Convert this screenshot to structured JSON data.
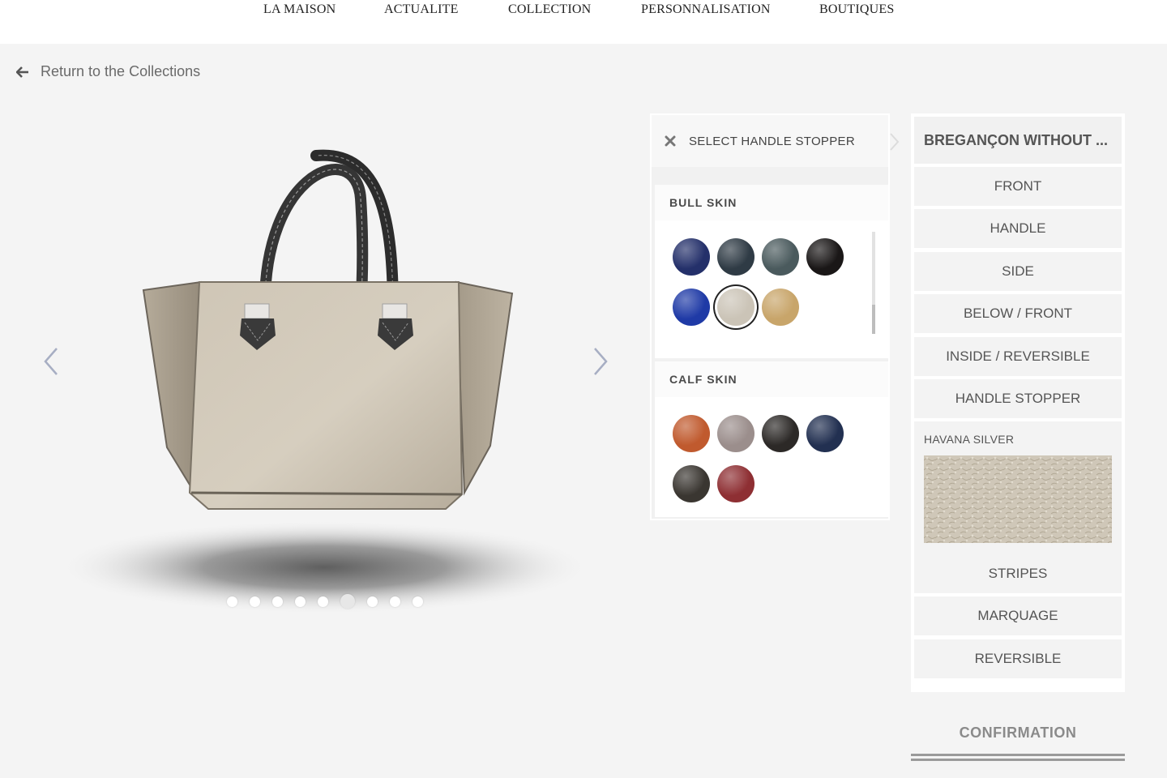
{
  "nav": {
    "items": [
      "LA MAISON",
      "ACTUALITE",
      "COLLECTION",
      "PERSONNALISATION",
      "BOUTIQUES"
    ]
  },
  "back": {
    "label": "Return to the Collections",
    "icon": "arrow-left-icon"
  },
  "carousel": {
    "dot_count": 9,
    "active_index": 5,
    "prev_icon": "chevron-left-icon",
    "next_icon": "chevron-right-icon"
  },
  "material_panel": {
    "title": "SELECT HANDLE STOPPER",
    "close_icon": "close-icon",
    "sections": [
      {
        "name": "BULL SKIN",
        "swatches": [
          "#24306a",
          "#2f3b45",
          "#4a5a5d",
          "#1a1717",
          "#1f3aa6",
          "#cbc4b7",
          "#c8a56a"
        ],
        "selected_index": 5
      },
      {
        "name": "CALF SKIN",
        "swatches": [
          "#c05a2e",
          "#9b8e8c",
          "#2c2927",
          "#223051",
          "#3a3631",
          "#8e2f33"
        ]
      }
    ]
  },
  "parts": {
    "heading": "BREGANÇON WITHOUT ...",
    "items_top": [
      "FRONT",
      "HANDLE",
      "SIDE",
      "BELOW / FRONT",
      "INSIDE / REVERSIBLE",
      "HANDLE STOPPER"
    ],
    "selected_material": "HAVANA SILVER",
    "items_bottom": [
      "STRIPES",
      "MARQUAGE",
      "REVERSIBLE"
    ],
    "confirm": "CONFIRMATION"
  },
  "colors": {
    "bag_leather": "#c9bfae",
    "handle": "#3c3c3c",
    "background": "#f4f4f4"
  }
}
